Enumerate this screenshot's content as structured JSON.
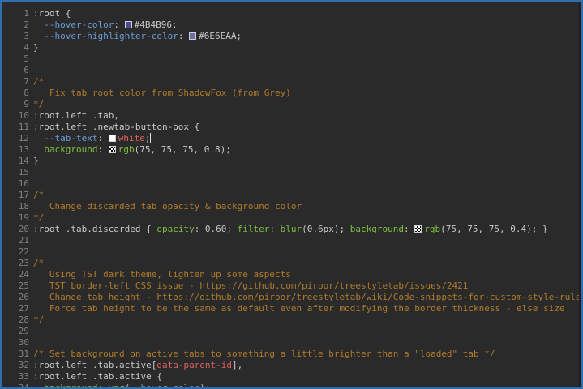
{
  "editor": {
    "accent": "#2F6FB0",
    "lines": [
      {
        "n": "1",
        "segs": [
          {
            "t": ":root {",
            "c": "sel"
          }
        ]
      },
      {
        "n": "2",
        "segs": [
          {
            "t": "  ",
            "c": "sel"
          },
          {
            "t": "--hover-color",
            "c": "var"
          },
          {
            "t": ": ",
            "c": "sel"
          },
          {
            "sw": "#4B4B96"
          },
          {
            "t": "#4B4B96;",
            "c": "sel"
          }
        ]
      },
      {
        "n": "3",
        "segs": [
          {
            "t": "  ",
            "c": "sel"
          },
          {
            "t": "--hover-highlighter-color",
            "c": "var"
          },
          {
            "t": ": ",
            "c": "sel"
          },
          {
            "sw": "#6E6EAA"
          },
          {
            "t": "#6E6EAA;",
            "c": "sel"
          }
        ]
      },
      {
        "n": "4",
        "segs": [
          {
            "t": "}",
            "c": "sel"
          }
        ]
      },
      {
        "n": "5",
        "segs": []
      },
      {
        "n": "6",
        "segs": []
      },
      {
        "n": "7",
        "segs": [
          {
            "t": "/*",
            "c": "com"
          }
        ]
      },
      {
        "n": "8",
        "segs": [
          {
            "t": "   Fix tab root color from ShadowFox (from Grey)",
            "c": "com"
          }
        ]
      },
      {
        "n": "9",
        "segs": [
          {
            "t": "*/",
            "c": "com"
          }
        ]
      },
      {
        "n": "10",
        "segs": [
          {
            "t": ":root.left .tab,",
            "c": "sel"
          }
        ]
      },
      {
        "n": "11",
        "segs": [
          {
            "t": ":root.left .newtab-button-box {",
            "c": "sel"
          }
        ]
      },
      {
        "n": "12",
        "segs": [
          {
            "t": "  ",
            "c": "sel"
          },
          {
            "t": "--tab-text",
            "c": "var"
          },
          {
            "t": ": ",
            "c": "sel"
          },
          {
            "sw": "#FFFFFF"
          },
          {
            "t": "white",
            "c": "str"
          },
          {
            "t": ";",
            "c": "sel"
          },
          {
            "cursor": true
          }
        ]
      },
      {
        "n": "13",
        "segs": [
          {
            "t": "  ",
            "c": "sel"
          },
          {
            "t": "background",
            "c": "prop"
          },
          {
            "t": ": ",
            "c": "sel"
          },
          {
            "sw": "checker"
          },
          {
            "t": "rgb",
            "c": "fn"
          },
          {
            "t": "(75, 75, 75, 0.8);",
            "c": "sel"
          }
        ]
      },
      {
        "n": "14",
        "segs": [
          {
            "t": "}",
            "c": "sel"
          }
        ]
      },
      {
        "n": "15",
        "segs": []
      },
      {
        "n": "16",
        "segs": []
      },
      {
        "n": "17",
        "segs": [
          {
            "t": "/*",
            "c": "com"
          }
        ]
      },
      {
        "n": "18",
        "segs": [
          {
            "t": "   Change discarded tab opacity & background color",
            "c": "com"
          }
        ]
      },
      {
        "n": "19",
        "segs": [
          {
            "t": "*/",
            "c": "com"
          }
        ]
      },
      {
        "n": "20",
        "segs": [
          {
            "t": ":root .tab.discarded { ",
            "c": "sel"
          },
          {
            "t": "opacity",
            "c": "prop"
          },
          {
            "t": ": 0.60; ",
            "c": "sel"
          },
          {
            "t": "filter",
            "c": "prop"
          },
          {
            "t": ": ",
            "c": "sel"
          },
          {
            "t": "blur",
            "c": "fn"
          },
          {
            "t": "(0.6px); ",
            "c": "sel"
          },
          {
            "t": "background",
            "c": "prop"
          },
          {
            "t": ": ",
            "c": "sel"
          },
          {
            "sw": "checker"
          },
          {
            "t": "rgb",
            "c": "fn"
          },
          {
            "t": "(75, 75, 75, 0.4); }",
            "c": "sel"
          }
        ]
      },
      {
        "n": "21",
        "segs": []
      },
      {
        "n": "22",
        "segs": []
      },
      {
        "n": "23",
        "segs": [
          {
            "t": "/*",
            "c": "com"
          }
        ]
      },
      {
        "n": "24",
        "segs": [
          {
            "t": "   Using TST dark theme, lighten up some aspects",
            "c": "com"
          }
        ]
      },
      {
        "n": "25",
        "segs": [
          {
            "t": "   TST border-left CSS issue - https://github.com/piroor/treestyletab/issues/2421",
            "c": "com"
          }
        ]
      },
      {
        "n": "26",
        "segs": [
          {
            "t": "   Change tab height - https://github.com/piroor/treestyletab/wiki/Code-snippets-for-custom-style-rules#change-",
            "c": "com"
          }
        ]
      },
      {
        "n": "27",
        "segs": [
          {
            "t": "   Force tab height to be the same as default even after modifying the border thickness - else size",
            "c": "com"
          }
        ]
      },
      {
        "n": "28",
        "segs": [
          {
            "t": "*/",
            "c": "com"
          }
        ]
      },
      {
        "n": "29",
        "segs": []
      },
      {
        "n": "30",
        "segs": []
      },
      {
        "n": "31",
        "segs": [
          {
            "t": "/* Set background on active tabs to something a little brighter than a \"loaded\" tab */",
            "c": "com"
          }
        ]
      },
      {
        "n": "32",
        "segs": [
          {
            "t": ":root.left .tab.active[",
            "c": "sel"
          },
          {
            "t": "data-parent-id",
            "c": "str"
          },
          {
            "t": "],",
            "c": "sel"
          }
        ]
      },
      {
        "n": "33",
        "segs": [
          {
            "t": ":root.left .tab.active {",
            "c": "sel"
          }
        ]
      },
      {
        "n": "34",
        "segs": [
          {
            "t": "  ",
            "c": "sel"
          },
          {
            "t": "background",
            "c": "prop"
          },
          {
            "t": ": ",
            "c": "sel"
          },
          {
            "t": "var",
            "c": "fn"
          },
          {
            "t": "(",
            "c": "sel"
          },
          {
            "t": "--hover-color",
            "c": "var"
          },
          {
            "t": ");",
            "c": "sel"
          }
        ]
      }
    ]
  }
}
